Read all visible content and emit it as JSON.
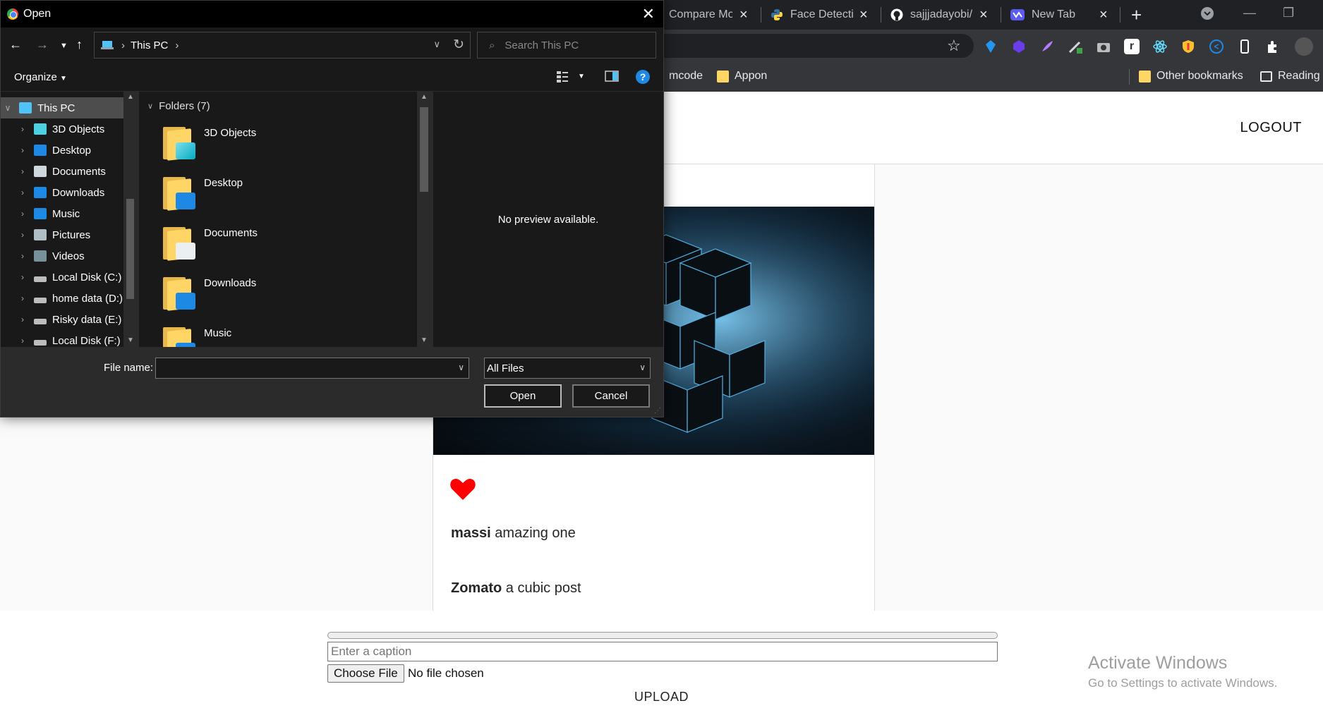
{
  "browser": {
    "tabs": [
      {
        "title": "Compare Mo",
        "icon": "compare-favicon"
      },
      {
        "title": "Face Detectio",
        "icon": "python-favicon"
      },
      {
        "title": "sajjjadayobi/",
        "icon": "github-favicon"
      },
      {
        "title": "New Tab",
        "icon": "new-tab-favicon"
      }
    ],
    "new_tab_symbol": "+",
    "bookmarks": [
      {
        "label": "mcode"
      },
      {
        "label": "Appon"
      },
      {
        "label": "Other bookmarks"
      },
      {
        "label": "Reading l"
      }
    ],
    "colors": {
      "tabstrip": "#202124",
      "toolbar": "#35363a"
    }
  },
  "app": {
    "logout_label": "LOGOUT",
    "post": {
      "liked": true,
      "heart_color": "#ff0000",
      "comments": [
        {
          "user": "massi",
          "text": "amazing one"
        },
        {
          "user": "Zomato",
          "text": "a cubic post"
        }
      ]
    },
    "upload_form": {
      "progress": 0,
      "caption_placeholder": "Enter a caption",
      "choose_file_label": "Choose File",
      "no_file_text": "No file chosen",
      "upload_label": "UPLOAD"
    }
  },
  "watermark": {
    "line1": "Activate Windows",
    "line2": "Go to Settings to activate Windows."
  },
  "dialog": {
    "title": "Open",
    "address": "This PC",
    "search_placeholder": "Search This PC",
    "organize_label": "Organize",
    "nav_items": [
      {
        "label": "This PC",
        "selected": true,
        "icon": "pc-icon"
      },
      {
        "label": "3D Objects",
        "icon": "3d-objects-icon"
      },
      {
        "label": "Desktop",
        "icon": "desktop-icon"
      },
      {
        "label": "Documents",
        "icon": "documents-icon"
      },
      {
        "label": "Downloads",
        "icon": "downloads-icon"
      },
      {
        "label": "Music",
        "icon": "music-icon"
      },
      {
        "label": "Pictures",
        "icon": "pictures-icon"
      },
      {
        "label": "Videos",
        "icon": "videos-icon"
      },
      {
        "label": "Local Disk (C:)",
        "icon": "drive-icon"
      },
      {
        "label": "home data (D:)",
        "icon": "drive-icon"
      },
      {
        "label": "Risky data (E:)",
        "icon": "drive-icon"
      },
      {
        "label": "Local Disk (F:)",
        "icon": "drive-icon"
      }
    ],
    "group_label": "Folders (7)",
    "folders": [
      {
        "label": "3D Objects",
        "icon": "3d-objects-folder-icon"
      },
      {
        "label": "Desktop",
        "icon": "desktop-folder-icon"
      },
      {
        "label": "Documents",
        "icon": "documents-folder-icon"
      },
      {
        "label": "Downloads",
        "icon": "downloads-folder-icon"
      },
      {
        "label": "Music",
        "icon": "music-folder-icon"
      }
    ],
    "preview_text": "No preview available.",
    "file_name_label": "File name:",
    "file_name_value": "",
    "file_type_value": "All Files",
    "open_label": "Open",
    "cancel_label": "Cancel"
  }
}
